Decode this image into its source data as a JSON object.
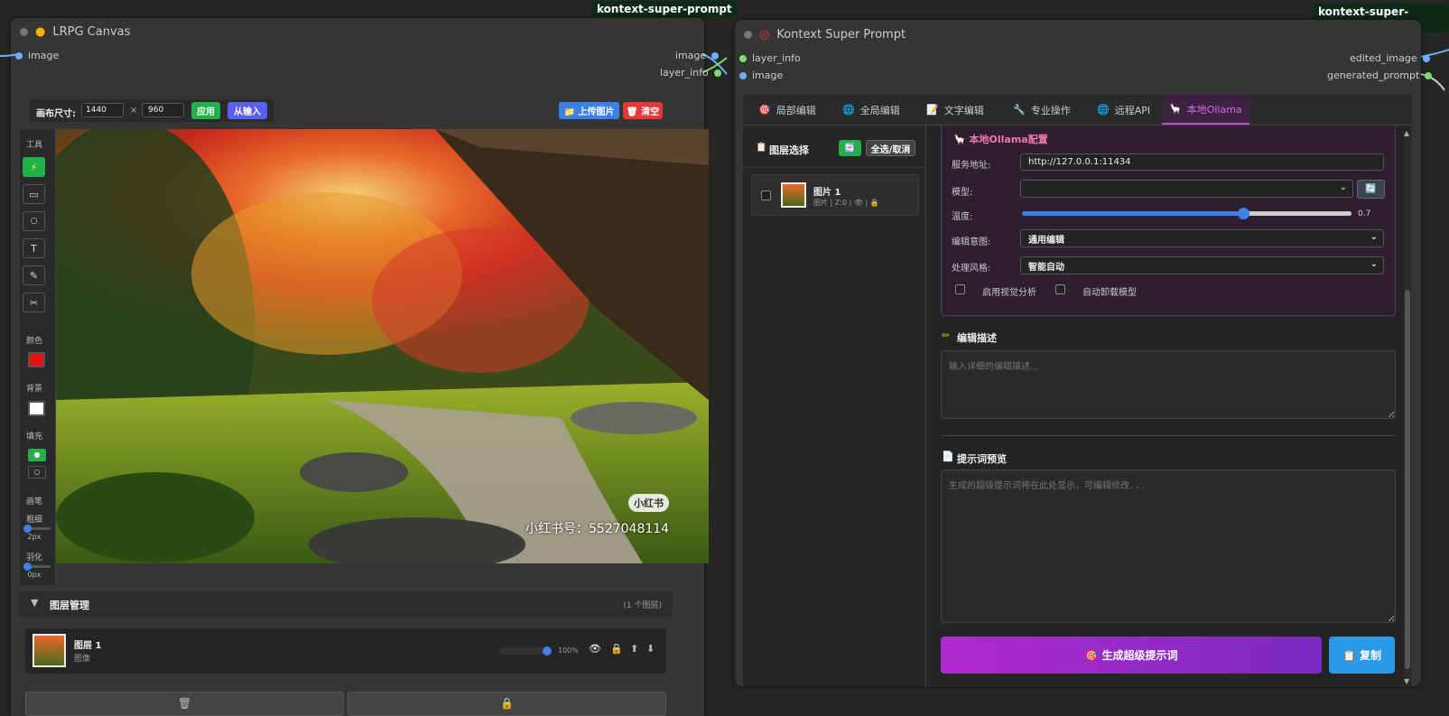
{
  "left_node": {
    "title": "LRPG Canvas",
    "tag": "kontext-super-prompt",
    "input_slot": "image",
    "output_slots": [
      "image",
      "layer_info"
    ],
    "canvas_size_label": "画布尺寸:",
    "width": "1440",
    "height": "960",
    "times": "×",
    "apply_label": "应用",
    "from_input_label": "从输入",
    "upload_label": "📁 上传图片",
    "clear_label": "🗑 清空",
    "tools_label": "工具",
    "color_label": "颜色",
    "bg_label": "背景",
    "fill_label": "填充",
    "brush_label": "画笔",
    "brush_size_label": "粗细",
    "brush_size_value": "2px",
    "feather_label": "羽化",
    "feather_value": "0px",
    "watermark_badge": "小红书",
    "watermark_text": "小红书号：5527048114",
    "layer_panel_title": "图层管理",
    "layer_count": "(1 个图层)",
    "layer_name": "图层 1",
    "layer_type": "图像",
    "opacity_value": "100%",
    "opacity_fraction": 1.0,
    "colors": {
      "accent": "#22b04b",
      "brush_color": "#e81010",
      "bg_color": "#ffffff"
    }
  },
  "right_node": {
    "title": "Kontext Super Prompt",
    "tag": "kontext-super-prompt",
    "input_slots": [
      "layer_info",
      "image"
    ],
    "output_slots": [
      "edited_image",
      "generated_prompt"
    ],
    "tabs": [
      {
        "icon": "🎯",
        "label": "局部编辑"
      },
      {
        "icon": "🌐",
        "label": "全局编辑"
      },
      {
        "icon": "📝",
        "label": "文字编辑"
      },
      {
        "icon": "🔧",
        "label": "专业操作"
      },
      {
        "icon": "🌐",
        "label": "远程API"
      },
      {
        "icon": "🦙",
        "label": "本地Ollama"
      }
    ],
    "layer_select_title": "图层选择",
    "select_all_label": "全选/取消",
    "layer_item_name": "图片 1",
    "layer_item_meta": "图片 | Z:0 | 👁 | 🔒",
    "ollama_title": "🦙 本地Ollama配置",
    "service_label": "服务地址:",
    "service_value": "http://127.0.0.1:11434",
    "model_label": "模型:",
    "model_value": "",
    "temperature_label": "温度:",
    "temperature_value": "0.7",
    "temperature_fraction": 0.67,
    "intent_label": "编辑意图:",
    "intent_value": "通用编辑",
    "style_label": "处理风格:",
    "style_value": "智能自动",
    "visual_analysis_label": "启用视觉分析",
    "auto_unload_label": "自动卸载模型",
    "desc_title": "编辑描述",
    "desc_placeholder": "输入详细的编辑描述...",
    "preview_title": "提示词预览",
    "preview_placeholder": "生成的超级提示词将在此处显示，可编辑修改...",
    "generate_label": "🎯 生成超级提示词",
    "copy_label": "📋 复制"
  }
}
